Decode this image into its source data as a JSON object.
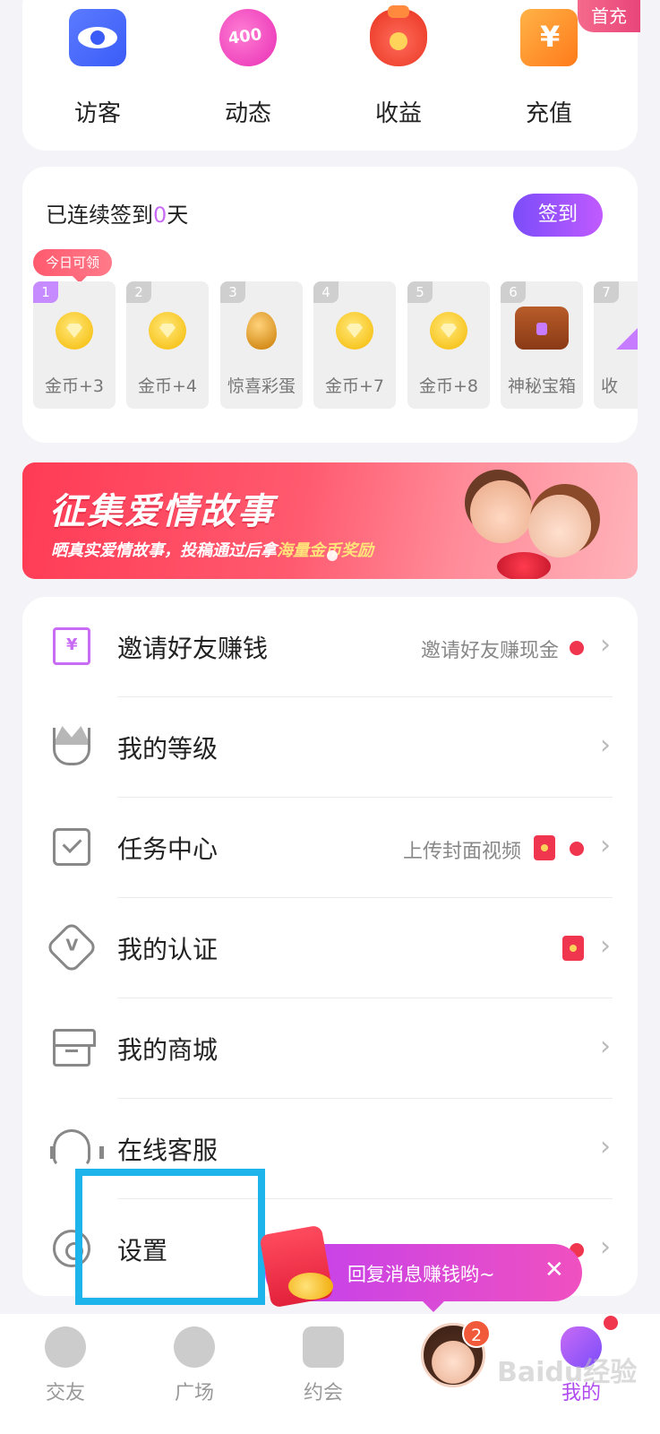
{
  "quick_entries": [
    {
      "label": "访客",
      "icon": "eye-icon"
    },
    {
      "label": "动态",
      "icon": "moment-icon"
    },
    {
      "label": "收益",
      "icon": "money-bag-icon"
    },
    {
      "label": "充值",
      "icon": "recharge-icon"
    }
  ],
  "recharge_badge": "首充",
  "checkin": {
    "title_prefix": "已连续签到",
    "days": "0",
    "title_suffix": "天",
    "button": "签到",
    "today_tag": "今日可领",
    "items": [
      {
        "day": "1",
        "label": "金币+3",
        "icon": "coin-icon"
      },
      {
        "day": "2",
        "label": "金币+4",
        "icon": "coin-icon"
      },
      {
        "day": "3",
        "label": "惊喜彩蛋",
        "icon": "golden-egg-icon"
      },
      {
        "day": "4",
        "label": "金币+7",
        "icon": "coin-icon"
      },
      {
        "day": "5",
        "label": "金币+8",
        "icon": "coin-icon"
      },
      {
        "day": "6",
        "label": "神秘宝箱",
        "icon": "treasure-chest-icon"
      },
      {
        "day": "7",
        "label": "收",
        "icon": "prize-icon"
      }
    ]
  },
  "banner": {
    "title": "征集爱情故事",
    "subtitle_prefix": "晒真实爱情故事，投稿通过后拿",
    "subtitle_highlight": "海量金币奖励"
  },
  "menu": [
    {
      "label": "邀请好友赚钱",
      "icon": "invite-icon",
      "right_text": "邀请好友赚现金",
      "red_dot": true,
      "red_envelope": false
    },
    {
      "label": "我的等级",
      "icon": "crown-icon",
      "right_text": "",
      "red_dot": false,
      "red_envelope": false
    },
    {
      "label": "任务中心",
      "icon": "task-check-icon",
      "right_text": "上传封面视频",
      "red_dot": true,
      "red_envelope": true
    },
    {
      "label": "我的认证",
      "icon": "verify-badge-icon",
      "right_text": "",
      "red_dot": false,
      "red_envelope": true
    },
    {
      "label": "我的商城",
      "icon": "store-icon",
      "right_text": "",
      "red_dot": false,
      "red_envelope": false
    },
    {
      "label": "在线客服",
      "icon": "headset-icon",
      "right_text": "",
      "red_dot": false,
      "red_envelope": false
    },
    {
      "label": "设置",
      "icon": "settings-gear-icon",
      "right_text": "",
      "red_dot": true,
      "red_envelope": false
    }
  ],
  "float_banner": {
    "text": "回复消息赚钱哟~",
    "close": "✕"
  },
  "bottom_nav": [
    {
      "label": "交友",
      "icon": "heart-chat-icon",
      "active": false
    },
    {
      "label": "广场",
      "icon": "leaf-icon",
      "active": false
    },
    {
      "label": "约会",
      "icon": "video-heart-icon",
      "active": false
    },
    {
      "label": "",
      "icon": "avatar",
      "badge": "2",
      "active": false
    },
    {
      "label": "我的",
      "icon": "profile-icon",
      "active": true
    }
  ],
  "watermark": "Baidu经验",
  "colors": {
    "accent": "#b04bf0",
    "highlight_box": "#1cb4ea",
    "red": "#f0364e"
  }
}
